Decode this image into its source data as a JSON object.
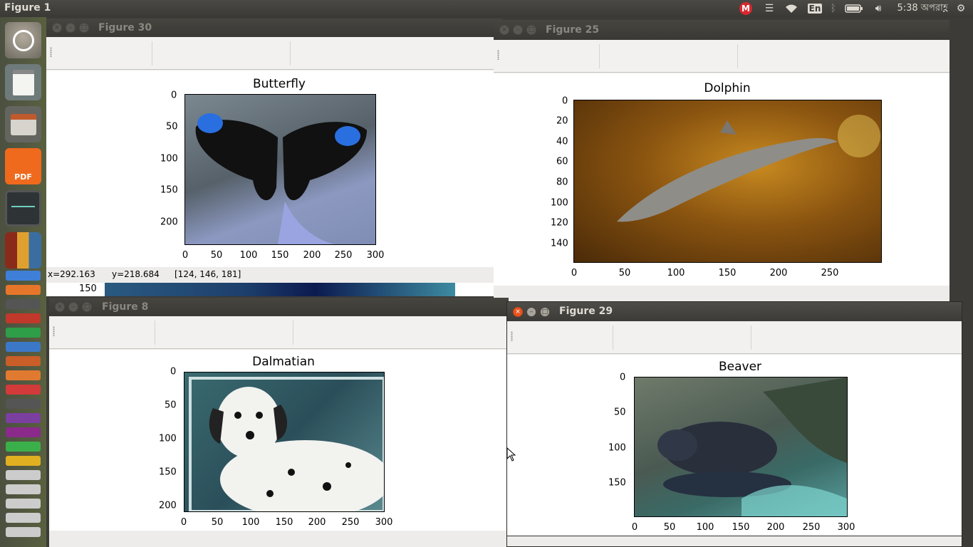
{
  "top_panel": {
    "app_title": "Figure 1",
    "keyboard_layout": "En",
    "clock": "5:38 অপরাহ্ণ"
  },
  "windows": {
    "fig30": {
      "title": "Figure 30",
      "plot_title": "Butterfly",
      "yticks": [
        "0",
        "50",
        "100",
        "150",
        "200"
      ],
      "xticks": [
        "0",
        "50",
        "100",
        "150",
        "200",
        "250",
        "300"
      ],
      "status": {
        "x": "x=292.163",
        "y": "y=218.684",
        "rgb": "[124, 146, 181]"
      },
      "hidden_tick": "150"
    },
    "fig25": {
      "title": "Figure 25",
      "plot_title": "Dolphin",
      "yticks": [
        "0",
        "20",
        "40",
        "60",
        "80",
        "100",
        "120",
        "140"
      ],
      "xticks": [
        "0",
        "50",
        "100",
        "150",
        "200",
        "250"
      ]
    },
    "fig8": {
      "title": "Figure 8",
      "plot_title": "Dalmatian",
      "yticks": [
        "0",
        "50",
        "100",
        "150",
        "200"
      ],
      "xticks": [
        "0",
        "50",
        "100",
        "150",
        "200",
        "250",
        "300"
      ]
    },
    "fig29": {
      "title": "Figure 29",
      "plot_title": "Beaver",
      "yticks": [
        "0",
        "50",
        "100",
        "150"
      ],
      "xticks": [
        "0",
        "50",
        "100",
        "150",
        "200",
        "250",
        "300"
      ]
    }
  },
  "launcher": {
    "pdf_label": "PDF"
  },
  "colors": {
    "accent": "#e95420",
    "panel": "#3c3b37"
  }
}
